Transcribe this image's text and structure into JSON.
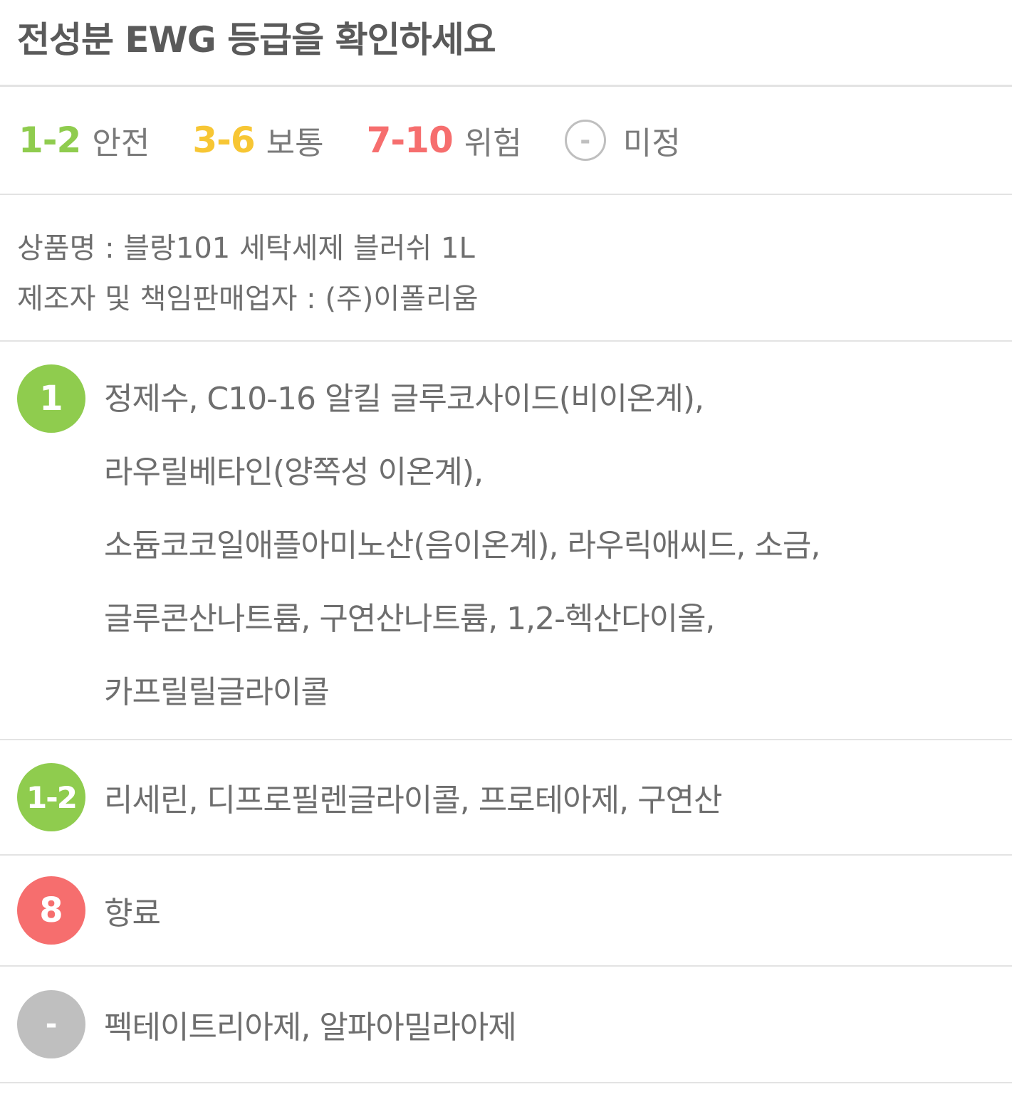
{
  "title": "전성분 EWG 등급을 확인하세요",
  "legend": [
    {
      "range": "1-2",
      "label": "안전",
      "color": "#8fcc4e"
    },
    {
      "range": "3-6",
      "label": "보통",
      "color": "#f7c634"
    },
    {
      "range": "7-10",
      "label": "위험",
      "color": "#f66e6e"
    },
    {
      "symbol": "-",
      "label": "미정",
      "color": "#bfbfbf"
    }
  ],
  "product": {
    "name_line": "상품명 : 블랑101 세탁세제 블러쉬 1L",
    "maker_line": "제조자 및 책임판매업자 : (주)이폴리움"
  },
  "groups": [
    {
      "grade": "1",
      "color": "#8fcc4e",
      "lines": [
        "정제수, C10-16 알킬 글루코사이드(비이온계),",
        "라우릴베타인(양쪽성 이온계),",
        "소듐코코일애플아미노산(음이온계), 라우릭애씨드, 소금,",
        "글루콘산나트륨, 구연산나트륨, 1,2-헥산다이올,",
        "카프릴릴글라이콜"
      ]
    },
    {
      "grade": "1-2",
      "color": "#8fcc4e",
      "lines": [
        "리세린, 디프로필렌글라이콜, 프로테아제, 구연산"
      ]
    },
    {
      "grade": "8",
      "color": "#f66e6e",
      "lines": [
        "향료"
      ]
    },
    {
      "grade": "-",
      "color": "#bfbfbf",
      "lines": [
        "펙테이트리아제, 알파아밀라아제"
      ]
    }
  ]
}
